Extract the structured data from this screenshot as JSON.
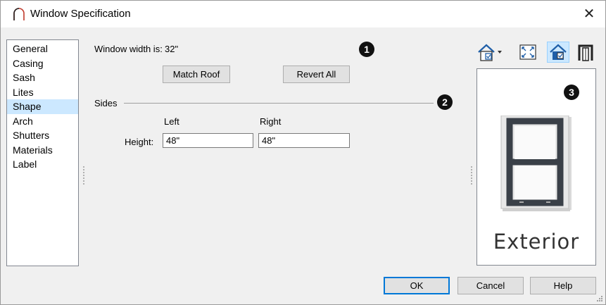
{
  "window": {
    "title": "Window Specification",
    "close_label": "✕"
  },
  "sidebar": {
    "items": [
      {
        "label": "General"
      },
      {
        "label": "Casing"
      },
      {
        "label": "Sash"
      },
      {
        "label": "Lites"
      },
      {
        "label": "Shape",
        "selected": true
      },
      {
        "label": "Arch"
      },
      {
        "label": "Shutters"
      },
      {
        "label": "Materials"
      },
      {
        "label": "Label"
      }
    ]
  },
  "main": {
    "width_label": "Window width is:",
    "width_value": "32\"",
    "match_roof_label": "Match Roof",
    "revert_all_label": "Revert All",
    "sides_label": "Sides",
    "left_label": "Left",
    "right_label": "Right",
    "height_label": "Height:",
    "left_height_value": "48\"",
    "right_height_value": "48\""
  },
  "callouts": [
    "1",
    "2",
    "3"
  ],
  "toolbar": {
    "icons": [
      "view-options-icon",
      "fill-window-icon",
      "color-toggle-icon",
      "interior-exterior-icon"
    ]
  },
  "preview": {
    "caption": "Exterior"
  },
  "footer": {
    "ok_label": "OK",
    "cancel_label": "Cancel",
    "help_label": "Help"
  },
  "colors": {
    "selection": "#cce8ff",
    "default_button_border": "#0078d7",
    "title_icon": "#c0392b"
  }
}
